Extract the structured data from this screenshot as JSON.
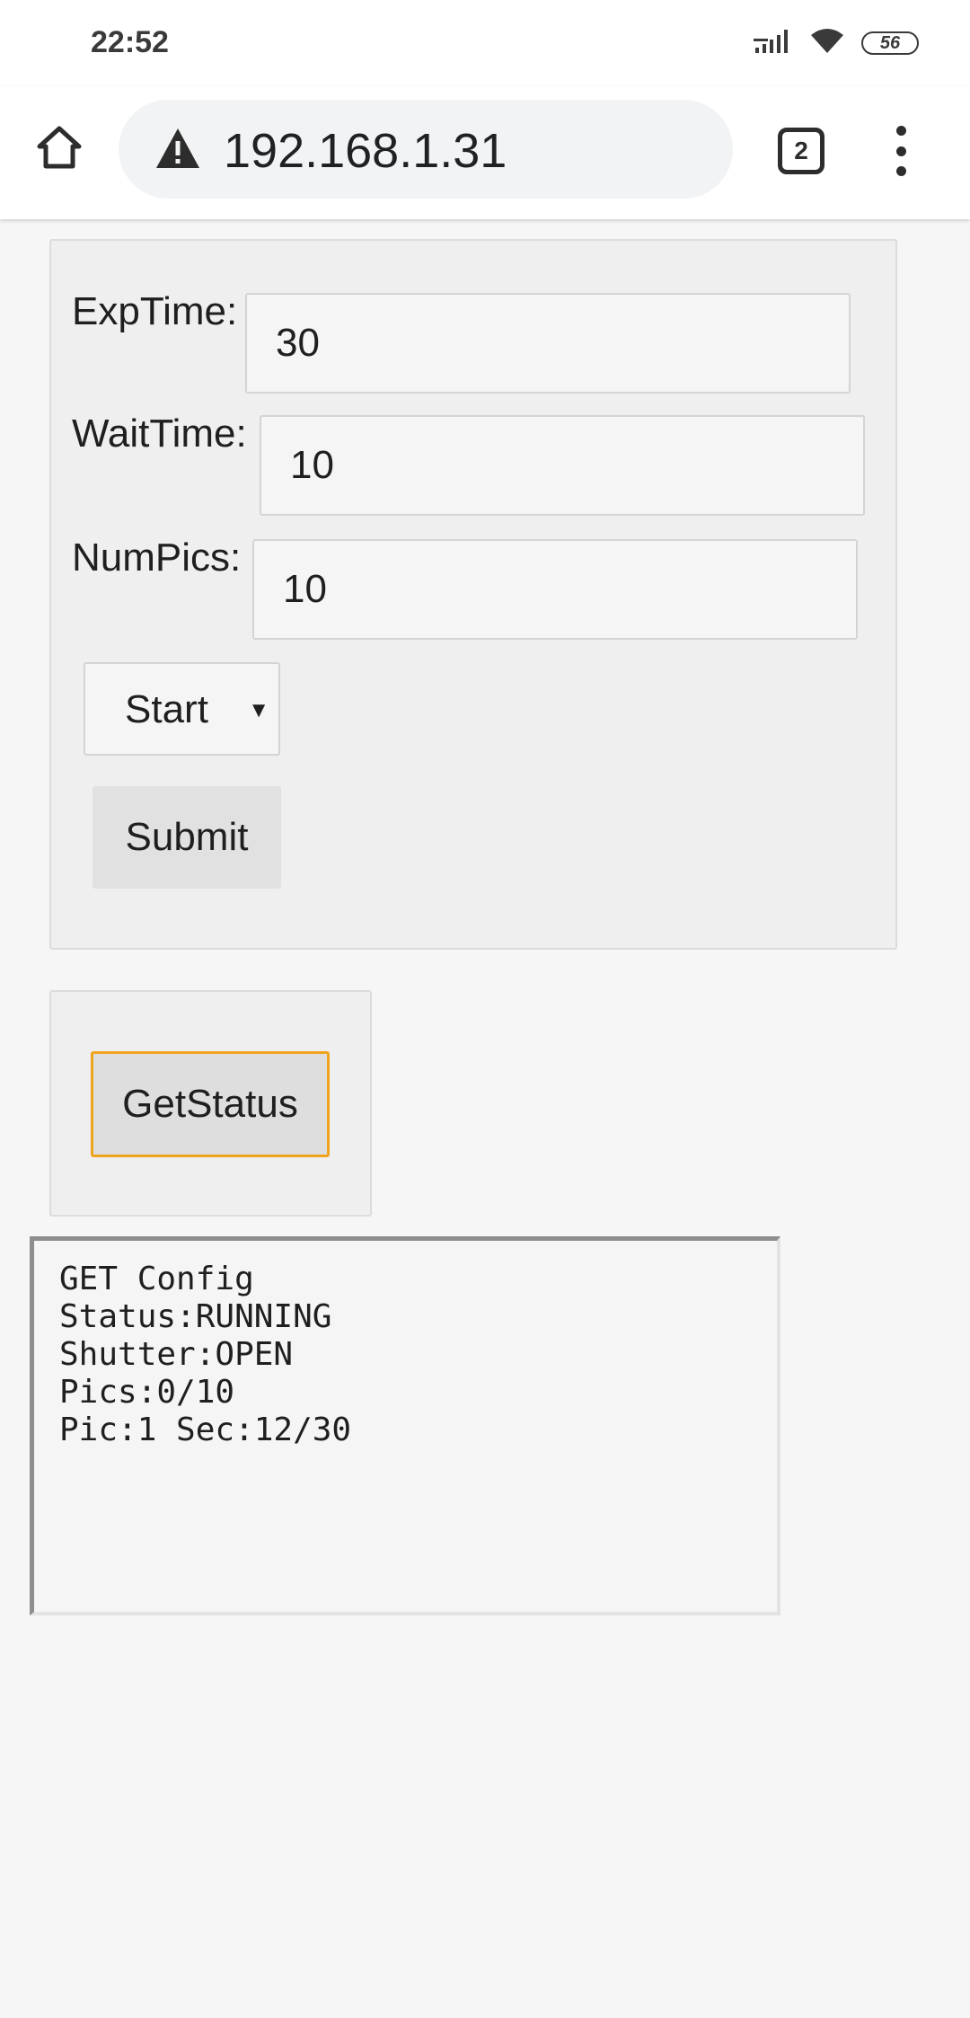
{
  "status_bar": {
    "time": "22:52",
    "battery": "56",
    "icons": [
      "signal-icon",
      "wifi-icon",
      "battery-icon"
    ]
  },
  "browser": {
    "url": "192.168.1.31",
    "tab_count": "2",
    "icons": [
      "home-icon",
      "warning-icon",
      "tabs-icon",
      "more-vert-icon"
    ]
  },
  "form": {
    "exp_time": {
      "label": "ExpTime:",
      "value": "30"
    },
    "wait_time": {
      "label": "WaitTime:",
      "value": "10"
    },
    "num_pics": {
      "label": "NumPics:",
      "value": "10"
    },
    "action_select": {
      "value": "Start"
    },
    "submit_label": "Submit"
  },
  "status_panel": {
    "button_label": "GetStatus",
    "accent_color": "#f0a41e"
  },
  "output": {
    "lines": [
      "GET Config",
      "Status:RUNNING",
      "Shutter:OPEN",
      "Pics:0/10",
      "Pic:1 Sec:12/30"
    ]
  }
}
